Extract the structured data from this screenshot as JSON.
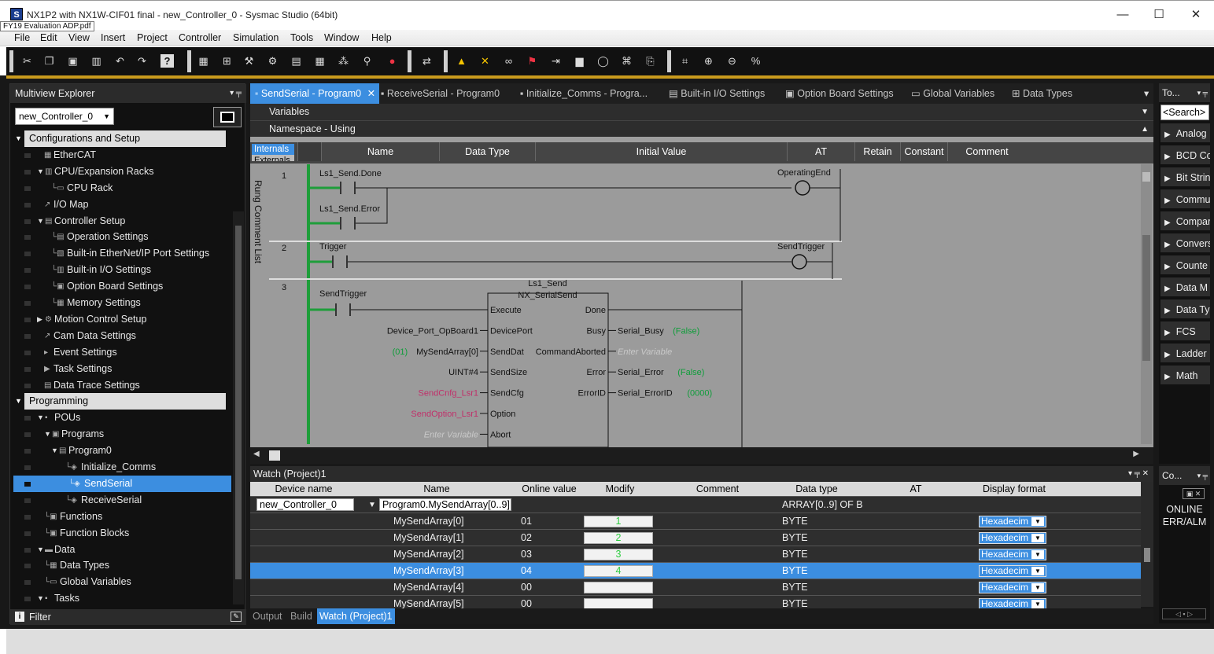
{
  "window": {
    "title": "NX1P2 with NX1W-CIF01 final - new_Controller_0 - Sysmac Studio (64bit)",
    "pdf_tooltip": "FY19 Evaluation ADP.pdf",
    "minimize": "—",
    "maximize": "☐",
    "close": "✕"
  },
  "menu": [
    "File",
    "Edit",
    "View",
    "Insert",
    "Project",
    "Controller",
    "Simulation",
    "Tools",
    "Window",
    "Help"
  ],
  "explorer": {
    "title": "Multiview Explorer",
    "controller": "new_Controller_0",
    "filter": "Filter",
    "tree": [
      {
        "label": "Configurations and Setup",
        "kind": "section"
      },
      {
        "label": "EtherCAT"
      },
      {
        "label": "CPU/Expansion Racks"
      },
      {
        "label": "CPU Rack"
      },
      {
        "label": "I/O Map"
      },
      {
        "label": "Controller Setup"
      },
      {
        "label": "Operation Settings"
      },
      {
        "label": "Built-in EtherNet/IP Port Settings"
      },
      {
        "label": "Built-in I/O Settings"
      },
      {
        "label": "Option Board Settings"
      },
      {
        "label": "Memory Settings"
      },
      {
        "label": "Motion Control Setup"
      },
      {
        "label": "Cam Data Settings"
      },
      {
        "label": "Event Settings"
      },
      {
        "label": "Task Settings"
      },
      {
        "label": "Data Trace Settings"
      },
      {
        "label": "Programming",
        "kind": "section"
      },
      {
        "label": "POUs"
      },
      {
        "label": "Programs"
      },
      {
        "label": "Program0"
      },
      {
        "label": "Initialize_Comms"
      },
      {
        "label": "SendSerial",
        "selected": true
      },
      {
        "label": "ReceiveSerial"
      },
      {
        "label": "Functions"
      },
      {
        "label": "Function Blocks"
      },
      {
        "label": "Data"
      },
      {
        "label": "Data Types"
      },
      {
        "label": "Global Variables"
      },
      {
        "label": "Tasks"
      }
    ]
  },
  "editor": {
    "tabs": [
      {
        "label": "SendSerial - Program0",
        "active": true
      },
      {
        "label": "ReceiveSerial - Program0"
      },
      {
        "label": "Initialize_Comms - Progra..."
      },
      {
        "label": "Built-in I/O Settings"
      },
      {
        "label": "Option Board Settings"
      },
      {
        "label": "Global Variables"
      },
      {
        "label": "Data Types"
      }
    ],
    "variables_label": "Variables",
    "namespace_label": "Namespace - Using",
    "var_tabs": [
      "Internals",
      "Externals"
    ],
    "var_columns": [
      "Name",
      "Data Type",
      "Initial Value",
      "AT",
      "Retain",
      "Constant",
      "Comment"
    ],
    "rung_comment_list": "Rung Comment List"
  },
  "ladder": {
    "rung1": {
      "num": "1",
      "contact1": "Ls1_Send.Done",
      "contact2": "Ls1_Send.Error",
      "coil": "OperatingEnd"
    },
    "rung2": {
      "num": "2",
      "contact": "Trigger",
      "coil": "SendTrigger"
    },
    "rung3": {
      "num": "3",
      "contact": "SendTrigger",
      "fb_instance": "Ls1_Send",
      "fb_type": "NX_SerialSend",
      "inputs": [
        {
          "pin": "Execute",
          "var": ""
        },
        {
          "pin": "DevicePort",
          "var": "Device_Port_OpBoard1",
          "style": "normal"
        },
        {
          "pin": "SendDat",
          "var": "MySendArray[0]",
          "value": "(01)",
          "style": "normal"
        },
        {
          "pin": "SendSize",
          "var": "UINT#4",
          "style": "normal"
        },
        {
          "pin": "SendCfg",
          "var": "SendCnfg_Lsr1",
          "style": "magenta"
        },
        {
          "pin": "Option",
          "var": "SendOption_Lsr1",
          "style": "magenta"
        },
        {
          "pin": "Abort",
          "var": "Enter Variable",
          "style": "placeholder"
        }
      ],
      "outputs": [
        {
          "pin": "Done",
          "var": ""
        },
        {
          "pin": "Busy",
          "var": "Serial_Busy",
          "value": "(False)"
        },
        {
          "pin": "CommandAborted",
          "var": "Enter Variable",
          "style": "placeholder"
        },
        {
          "pin": "Error",
          "var": "Serial_Error",
          "value": "(False)"
        },
        {
          "pin": "ErrorID",
          "var": "Serial_ErrorID",
          "value": "(0000)"
        }
      ]
    }
  },
  "watch": {
    "title": "Watch (Project)1",
    "columns": [
      "Device name",
      "Name",
      "Online value",
      "Modify",
      "Comment",
      "Data type",
      "AT",
      "Display format"
    ],
    "parent": {
      "device": "new_Controller_0",
      "name": "Program0.MySendArray[0..9]",
      "type": "ARRAY[0..9] OF B"
    },
    "rows": [
      {
        "name": "MySendArray[0]",
        "online": "01",
        "modify": "1",
        "type": "BYTE",
        "format": "Hexadecim"
      },
      {
        "name": "MySendArray[1]",
        "online": "02",
        "modify": "2",
        "type": "BYTE",
        "format": "Hexadecim"
      },
      {
        "name": "MySendArray[2]",
        "online": "03",
        "modify": "3",
        "type": "BYTE",
        "format": "Hexadecim"
      },
      {
        "name": "MySendArray[3]",
        "online": "04",
        "modify": "4",
        "type": "BYTE",
        "format": "Hexadecim",
        "selected": true
      },
      {
        "name": "MySendArray[4]",
        "online": "00",
        "modify": "",
        "type": "BYTE",
        "format": "Hexadecim"
      },
      {
        "name": "MySendArray[5]",
        "online": "00",
        "modify": "",
        "type": "BYTE",
        "format": "Hexadecim"
      }
    ],
    "bottom_tabs": [
      "Output",
      "Build",
      "Watch (Project)1"
    ]
  },
  "toolbox": {
    "title": "To...",
    "search": "<Search>",
    "items": [
      "Analog",
      "BCD Co",
      "Bit Strin",
      "Commu",
      "Compar",
      "Convers",
      "Counte",
      "Data M",
      "Data Ty",
      "FCS",
      "Ladder",
      "Math"
    ]
  },
  "controller_status": {
    "title": "Co...",
    "online": "ONLINE",
    "err": "ERR/ALM"
  },
  "colors": {
    "accent": "#3c8ee0",
    "rail": "#1e9e3a",
    "gold": "#c99a1d",
    "magenta": "#c0306a",
    "green_value": "#0f9d3a"
  }
}
